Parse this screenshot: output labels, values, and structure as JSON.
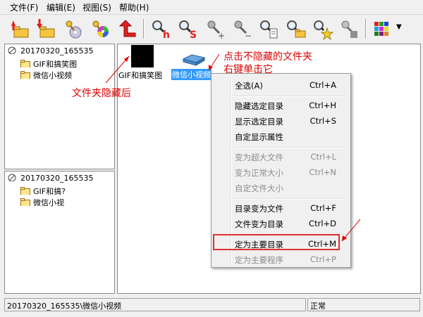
{
  "menubar": {
    "items": [
      "文件(F)",
      "编辑(E)",
      "视图(S)",
      "帮助(H)"
    ]
  },
  "toolbar": {
    "icons": [
      "folder-up-red-arrow-icon",
      "folder-down-red-arrow-icon",
      "key-disc-icon",
      "key-colorwheel-icon",
      "red-l-arrow-icon",
      "magnifier-h-icon",
      "magnifier-s-icon",
      "key-plus-icon",
      "key-minus-icon",
      "magnifier-doc-icon",
      "magnifier-folder-icon",
      "magnifier-star-icon",
      "key-gray-icon",
      "color-grid-icon",
      "dropdown-arrow-icon"
    ],
    "glyph_h": "h",
    "glyph_s": "S",
    "glyph_plus": "+",
    "glyph_minus": "−",
    "dropdown": "▼"
  },
  "tree_top": {
    "root": "20170320_165535",
    "children": [
      "GIF和搞笑图",
      "微信小视频"
    ]
  },
  "tree_bottom": {
    "root": "20170320_165535",
    "children": [
      "GIF和搞?",
      "微信小视"
    ]
  },
  "main": {
    "items": [
      {
        "label": "GIF和搞笑图",
        "selected": false
      },
      {
        "label": "微信小视频",
        "selected": true
      }
    ]
  },
  "context_menu": {
    "items": [
      {
        "label": "全选(A)",
        "shortcut": "Ctrl+A",
        "enabled": true
      },
      {
        "label": "隐藏选定目录",
        "shortcut": "Ctrl+H",
        "enabled": true
      },
      {
        "label": "显示选定目录",
        "shortcut": "Ctrl+S",
        "enabled": true
      },
      {
        "label": "自定显示属性",
        "shortcut": "",
        "enabled": true
      },
      {
        "label": "变为超大文件",
        "shortcut": "Ctrl+L",
        "enabled": false
      },
      {
        "label": "变为正常大小",
        "shortcut": "Ctrl+N",
        "enabled": false
      },
      {
        "label": "自定文件大小",
        "shortcut": "",
        "enabled": false
      },
      {
        "label": "目录变为文件",
        "shortcut": "Ctrl+F",
        "enabled": true
      },
      {
        "label": "文件变为目录",
        "shortcut": "Ctrl+D",
        "enabled": true
      },
      {
        "label": "定为主要目录",
        "shortcut": "Ctrl+M",
        "enabled": true
      },
      {
        "label": "定为主要程序",
        "shortcut": "Ctrl+P",
        "enabled": false
      }
    ]
  },
  "annotations": {
    "hidden_note": "文件夹隐藏后",
    "click_note_line1": "点击不隐藏的文件夹",
    "click_note_line2": "右键单击它"
  },
  "statusbar": {
    "path": "20170320_165535\\微信小视频",
    "state": "正常"
  },
  "colors": {
    "annotation_red": "#e00000",
    "selection_blue": "#3399ff",
    "window_bg": "#f0f0f0"
  }
}
